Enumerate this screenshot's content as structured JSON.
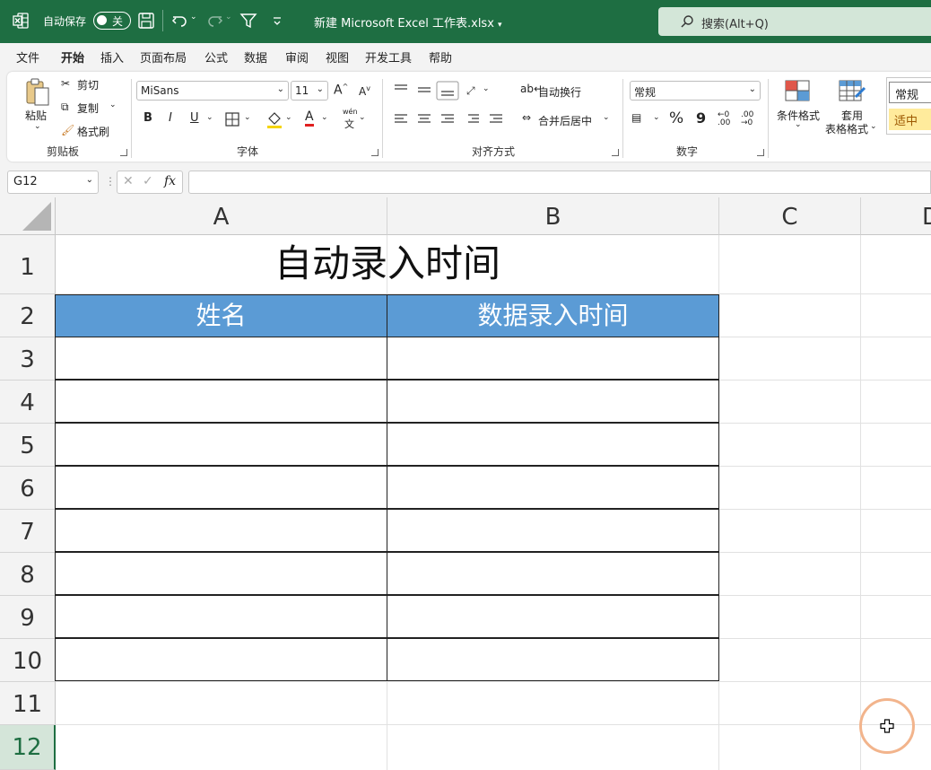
{
  "titlebar": {
    "autosave_label": "自动保存",
    "autosave_state": "关",
    "filename": "新建 Microsoft Excel 工作表.xlsx",
    "search_placeholder": "搜索(Alt+Q)"
  },
  "menu": {
    "tabs": [
      "文件",
      "开始",
      "插入",
      "页面布局",
      "公式",
      "数据",
      "审阅",
      "视图",
      "开发工具",
      "帮助"
    ],
    "active": "开始"
  },
  "ribbon": {
    "clipboard": {
      "paste": "粘贴",
      "cut": "剪切",
      "copy": "复制",
      "format_painter": "格式刷",
      "label": "剪贴板"
    },
    "font": {
      "name": "MiSans",
      "size": "11",
      "label": "字体",
      "bold": "B",
      "italic": "I",
      "underline": "U",
      "font_color": "A",
      "phonetic_top": "wén",
      "phonetic_bottom": "文",
      "grow": "A",
      "shrink": "A"
    },
    "alignment": {
      "wrap_text": "自动换行",
      "merge_center": "合并后居中",
      "label": "对齐方式"
    },
    "number": {
      "format": "常规",
      "percent": "%",
      "comma": "9",
      "label": "数字"
    },
    "styles": {
      "conditional": "条件格式",
      "table_format_line1": "套用",
      "table_format_line2": "表格格式",
      "style_normal": "常规",
      "style_neutral": "适中"
    }
  },
  "formula_bar": {
    "name_box": "G12",
    "fx": "fx",
    "value": ""
  },
  "sheet": {
    "columns": [
      "A",
      "B",
      "C",
      "D"
    ],
    "rows": [
      "1",
      "2",
      "3",
      "4",
      "5",
      "6",
      "7",
      "8",
      "9",
      "10",
      "11",
      "12"
    ],
    "selected_row": "12",
    "title": "自动录入时间",
    "headers": [
      "姓名",
      "数据录入时间"
    ],
    "header_color": "#5b9bd5"
  },
  "colors": {
    "brand": "#1e6e42",
    "accent_ring": "#f2b48c"
  }
}
